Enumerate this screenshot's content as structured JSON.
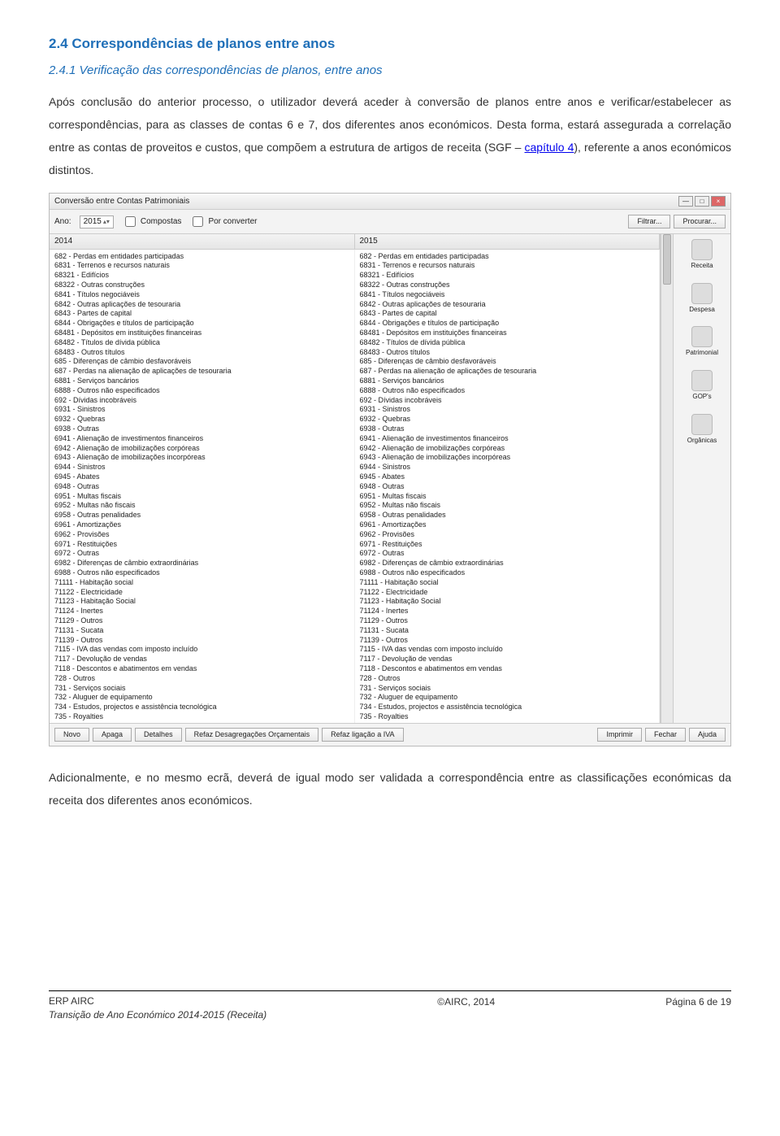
{
  "headings": {
    "h2": "2.4 Correspondências de planos entre anos",
    "h3": "2.4.1 Verificação das correspondências de planos, entre anos"
  },
  "paragraphs": {
    "p1_pre": "Após conclusão do anterior processo, o utilizador deverá aceder à conversão de planos entre anos e verificar/estabelecer as correspondências, para as classes de contas 6 e 7, dos diferentes anos económicos. Desta forma, estará assegurada a correlação entre as contas de proveitos e custos, que compõem a estrutura de artigos de receita (SGF – ",
    "p1_link": "capítulo 4",
    "p1_post": "), referente a anos económicos distintos.",
    "p2": "Adicionalmente, e no mesmo ecrã, deverá de igual modo ser validada a correspondência entre as classificações económicas da receita dos diferentes anos económicos."
  },
  "window": {
    "title": "Conversão entre Contas Patrimoniais",
    "year_label": "Ano:",
    "year_value": "2015",
    "cb_compostas": "Compostas",
    "cb_porconverter": "Por converter",
    "btn_filtrar": "Filtrar...",
    "btn_procurar": "Procurar...",
    "col_2014": "2014",
    "col_2015": "2015",
    "rows": [
      "682 - Perdas em entidades participadas",
      "6831 - Terrenos e recursos naturais",
      "68321 - Edifícios",
      "68322 - Outras construções",
      "6841 - Títulos negociáveis",
      "6842 - Outras aplicações de tesouraria",
      "6843 - Partes de capital",
      "6844 - Obrigações e títulos de participação",
      "68481 - Depósitos em instituições financeiras",
      "68482 - Títulos de dívida pública",
      "68483 - Outros títulos",
      "685 - Diferenças de câmbio desfavoráveis",
      "687 - Perdas na alienação de aplicações de tesouraria",
      "6881 - Serviços bancários",
      "6888 - Outros não especificados",
      "692 - Dívidas incobráveis",
      "6931 - Sinistros",
      "6932 - Quebras",
      "6938 - Outras",
      "6941 - Alienação de investimentos financeiros",
      "6942 - Alienação de imobilizações corpóreas",
      "6943 - Alienação de imobilizações incorpóreas",
      "6944 - Sinistros",
      "6945 - Abates",
      "6948 - Outras",
      "6951 - Multas fiscais",
      "6952 - Multas não fiscais",
      "6958 - Outras penalidades",
      "6961 - Amortizações",
      "6962 - Provisões",
      "6971 - Restituições",
      "6972 - Outras",
      "6982 - Diferenças de câmbio extraordinárias",
      "6988 - Outros não especificados",
      "71111 - Habitação social",
      "71122 - Electricidade",
      "71123 - Habitação Social",
      "71124 - Inertes",
      "71129 - Outros",
      "71131 - Sucata",
      "71139 - Outros",
      "7115 - IVA das vendas com imposto incluído",
      "7117 - Devolução de vendas",
      "7118 - Descontos e abatimentos em vendas",
      "728 - Outros",
      "731 - Serviços sociais",
      "732 - Aluguer de equipamento",
      "734 - Estudos, projectos e assistência tecnológica",
      "735 - Royalties"
    ],
    "side": [
      "Receita",
      "Despesa",
      "Patrimonial",
      "GOP's",
      "Orgânicas"
    ],
    "btn_novo": "Novo",
    "btn_apaga": "Apaga",
    "btn_detalhes": "Detalhes",
    "btn_refaz_orc": "Refaz Desagregações Orçamentais",
    "btn_refaz_iva": "Refaz ligação a IVA",
    "btn_imprimir": "Imprimir",
    "btn_fechar": "Fechar",
    "btn_ajuda": "Ajuda"
  },
  "footer": {
    "left1": "ERP AIRC",
    "left2": "Transição de Ano Económico 2014-2015 (Receita)",
    "center": "©AIRC, 2014",
    "right": "Página 6 de 19"
  }
}
